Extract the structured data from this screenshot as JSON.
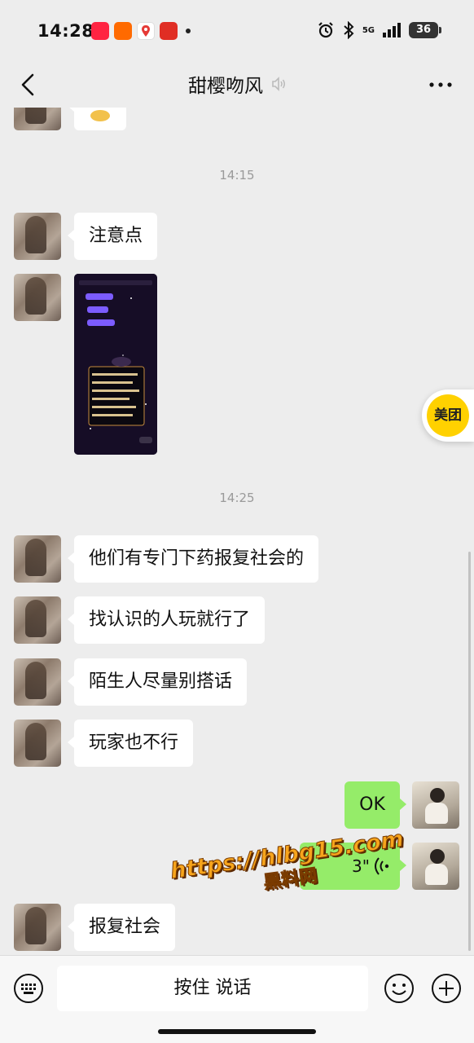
{
  "status_bar": {
    "time": "14:28",
    "network": "5G",
    "battery": "36",
    "icons": [
      "xiaohongshu-app-icon",
      "taobao-app-icon",
      "maps-app-icon",
      "pinduoduo-app-icon",
      "alarm-icon",
      "bluetooth-icon",
      "signal-icon",
      "battery-icon"
    ]
  },
  "nav": {
    "title": "甜樱吻风",
    "back_icon": "chevron-left-icon",
    "muted_icon": "voice-muted-icon",
    "more_icon": "more-icon"
  },
  "chat": {
    "timestamps": [
      "14:15",
      "14:25"
    ],
    "messages": [
      {
        "from": "contact",
        "type": "sticker"
      },
      {
        "from": "contact",
        "type": "text",
        "text": "注意点"
      },
      {
        "from": "contact",
        "type": "image"
      },
      {
        "from": "contact",
        "type": "text",
        "text": "他们有专门下药报复社会的"
      },
      {
        "from": "contact",
        "type": "text",
        "text": "找认识的人玩就行了"
      },
      {
        "from": "contact",
        "type": "text",
        "text": "陌生人尽量别搭话"
      },
      {
        "from": "contact",
        "type": "text",
        "text": "玩家也不行"
      },
      {
        "from": "me",
        "type": "text",
        "text": "OK"
      },
      {
        "from": "me",
        "type": "voice",
        "duration": "3\""
      },
      {
        "from": "contact",
        "type": "text",
        "text": "报复社会"
      }
    ]
  },
  "floating_badge": {
    "label": "美团"
  },
  "watermark": {
    "url": "https://hlbg15.com",
    "text": "黑料网"
  },
  "input_bar": {
    "hold_to_talk": "按住 说话",
    "icons": [
      "keyboard-icon",
      "emoji-icon",
      "plus-icon"
    ]
  },
  "colors": {
    "background": "#ededed",
    "bubble_in": "#ffffff",
    "bubble_out": "#95ec69",
    "meituan": "#ffd100"
  }
}
